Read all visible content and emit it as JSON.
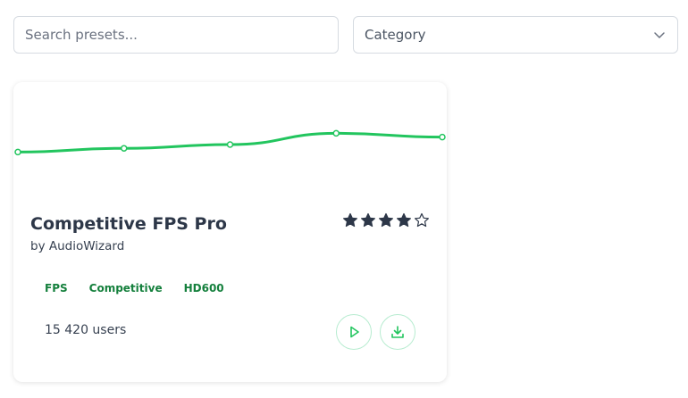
{
  "search": {
    "placeholder": "Search presets..."
  },
  "category": {
    "label": "Category",
    "icon": "chevron-down-icon"
  },
  "card": {
    "title": "Competitive FPS Pro",
    "author": "by AudioWizard",
    "rating": 4,
    "rating_max": 5,
    "tags": [
      "FPS",
      "Competitive",
      "HD600"
    ],
    "users": "15 420 users",
    "actions": {
      "play_icon": "play-icon",
      "download_icon": "download-icon"
    },
    "eq_curve": [
      0.56,
      0.53,
      0.5,
      0.41,
      0.44
    ]
  },
  "colors": {
    "accent": "#22c55e",
    "tag_text": "#15803d",
    "star": "#2d3748",
    "button_border": "#b7ecd0"
  }
}
